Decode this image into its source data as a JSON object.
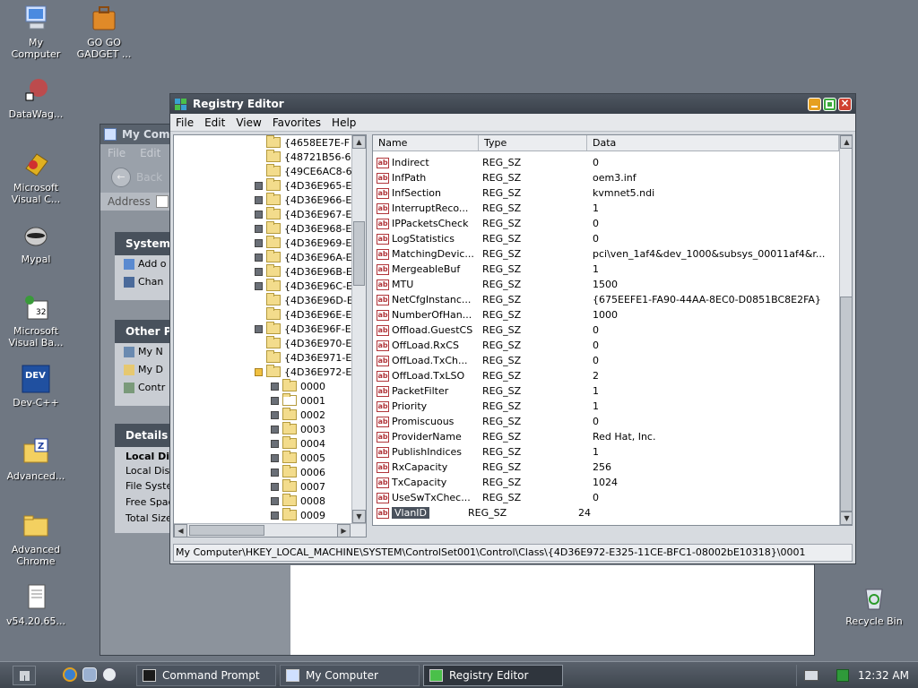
{
  "desktop": {
    "icons": [
      {
        "label": "My\nComputer",
        "icon": "computer-icon"
      },
      {
        "label": "GO GO\nGADGET ...",
        "icon": "briefcase-icon"
      },
      {
        "label": "DataWag...",
        "icon": "shortcut-icon"
      },
      {
        "label": "Microsoft\nVisual C...",
        "icon": "visual-c-icon"
      },
      {
        "label": "Mypal",
        "icon": "raccoon-icon"
      },
      {
        "label": "Microsoft\nVisual Ba...",
        "icon": "visual-basic-icon"
      },
      {
        "label": "Dev-C++",
        "icon": "dev-cpp-icon"
      },
      {
        "label": "Advanced...",
        "icon": "zip-folder-icon"
      },
      {
        "label": "Advanced\nChrome",
        "icon": "folder-icon"
      },
      {
        "label": "v54.20.65...",
        "icon": "document-icon"
      },
      {
        "label": "Recycle Bin",
        "icon": "recycle-bin-icon"
      }
    ]
  },
  "mycomputer": {
    "title": "My Com",
    "menu": [
      "File",
      "Edit"
    ],
    "back_label": "Back",
    "address_label": "Address",
    "system_tasks": {
      "title": "System T",
      "items": [
        "Add o",
        "Chan"
      ]
    },
    "other_places": {
      "title": "Other Pla",
      "items": [
        "My N",
        "My D",
        "Contr"
      ]
    },
    "details": {
      "title": "Details",
      "name": "Local Dis",
      "items": [
        "Local Disk",
        "File Syster",
        "Free Spac",
        "Total Size"
      ]
    }
  },
  "regedit": {
    "title": "Registry Editor",
    "menu": [
      "File",
      "Edit",
      "View",
      "Favorites",
      "Help"
    ],
    "tree": [
      {
        "label": "{4658EE7E-F",
        "expander": false,
        "level": 0
      },
      {
        "label": "{48721B56-6",
        "expander": false,
        "level": 0
      },
      {
        "label": "{49CE6AC8-6",
        "expander": false,
        "level": 0
      },
      {
        "label": "{4D36E965-E",
        "expander": true,
        "level": 0
      },
      {
        "label": "{4D36E966-E",
        "expander": true,
        "level": 0
      },
      {
        "label": "{4D36E967-E",
        "expander": true,
        "level": 0
      },
      {
        "label": "{4D36E968-E",
        "expander": true,
        "level": 0
      },
      {
        "label": "{4D36E969-E",
        "expander": true,
        "level": 0
      },
      {
        "label": "{4D36E96A-E",
        "expander": true,
        "level": 0
      },
      {
        "label": "{4D36E96B-E",
        "expander": true,
        "level": 0
      },
      {
        "label": "{4D36E96C-E",
        "expander": true,
        "level": 0
      },
      {
        "label": "{4D36E96D-E",
        "expander": false,
        "level": 0
      },
      {
        "label": "{4D36E96E-E",
        "expander": false,
        "level": 0
      },
      {
        "label": "{4D36E96F-E",
        "expander": true,
        "level": 0
      },
      {
        "label": "{4D36E970-E",
        "expander": false,
        "level": 0
      },
      {
        "label": "{4D36E971-E",
        "expander": false,
        "level": 0
      },
      {
        "label": "{4D36E972-E",
        "expander": true,
        "level": 0,
        "open": true
      },
      {
        "label": "0000",
        "expander": true,
        "level": 1
      },
      {
        "label": "0001",
        "expander": true,
        "level": 1,
        "selected": true
      },
      {
        "label": "0002",
        "expander": true,
        "level": 1
      },
      {
        "label": "0003",
        "expander": true,
        "level": 1
      },
      {
        "label": "0004",
        "expander": true,
        "level": 1
      },
      {
        "label": "0005",
        "expander": true,
        "level": 1
      },
      {
        "label": "0006",
        "expander": true,
        "level": 1
      },
      {
        "label": "0007",
        "expander": true,
        "level": 1
      },
      {
        "label": "0008",
        "expander": true,
        "level": 1
      },
      {
        "label": "0009",
        "expander": true,
        "level": 1
      }
    ],
    "columns": [
      "Name",
      "Type",
      "Data"
    ],
    "values": [
      {
        "name": "Indirect",
        "type": "REG_SZ",
        "data": "0"
      },
      {
        "name": "InfPath",
        "type": "REG_SZ",
        "data": "oem3.inf"
      },
      {
        "name": "InfSection",
        "type": "REG_SZ",
        "data": "kvmnet5.ndi"
      },
      {
        "name": "InterruptReco...",
        "type": "REG_SZ",
        "data": "1"
      },
      {
        "name": "IPPacketsCheck",
        "type": "REG_SZ",
        "data": "0"
      },
      {
        "name": "LogStatistics",
        "type": "REG_SZ",
        "data": "0"
      },
      {
        "name": "MatchingDevic...",
        "type": "REG_SZ",
        "data": "pci\\ven_1af4&dev_1000&subsys_00011af4&r..."
      },
      {
        "name": "MergeableBuf",
        "type": "REG_SZ",
        "data": "1"
      },
      {
        "name": "MTU",
        "type": "REG_SZ",
        "data": "1500"
      },
      {
        "name": "NetCfgInstanc...",
        "type": "REG_SZ",
        "data": "{675EEFE1-FA90-44AA-8EC0-D0851BC8E2FA}"
      },
      {
        "name": "NumberOfHan...",
        "type": "REG_SZ",
        "data": "1000"
      },
      {
        "name": "Offload.GuestCS",
        "type": "REG_SZ",
        "data": "0"
      },
      {
        "name": "OffLoad.RxCS",
        "type": "REG_SZ",
        "data": "0"
      },
      {
        "name": "OffLoad.TxCh...",
        "type": "REG_SZ",
        "data": "0"
      },
      {
        "name": "OffLoad.TxLSO",
        "type": "REG_SZ",
        "data": "2"
      },
      {
        "name": "PacketFilter",
        "type": "REG_SZ",
        "data": "1"
      },
      {
        "name": "Priority",
        "type": "REG_SZ",
        "data": "1"
      },
      {
        "name": "Promiscuous",
        "type": "REG_SZ",
        "data": "0"
      },
      {
        "name": "ProviderName",
        "type": "REG_SZ",
        "data": "Red Hat, Inc."
      },
      {
        "name": "PublishIndices",
        "type": "REG_SZ",
        "data": "1"
      },
      {
        "name": "RxCapacity",
        "type": "REG_SZ",
        "data": "256"
      },
      {
        "name": "TxCapacity",
        "type": "REG_SZ",
        "data": "1024"
      },
      {
        "name": "UseSwTxChec...",
        "type": "REG_SZ",
        "data": "0"
      },
      {
        "name": "VlanID",
        "type": "REG_SZ",
        "data": "24",
        "selected": true
      }
    ],
    "status_path": "My Computer\\HKEY_LOCAL_MACHINE\\SYSTEM\\ControlSet001\\Control\\Class\\{4D36E972-E325-11CE-BFC1-08002bE10318}\\0001"
  },
  "taskbar": {
    "tasks": [
      {
        "label": "Command Prompt",
        "icon": "cmd-icon"
      },
      {
        "label": "My Computer",
        "icon": "computer-icon"
      },
      {
        "label": "Registry Editor",
        "icon": "regedit-icon",
        "active": true
      }
    ],
    "clock": "12:32 AM"
  }
}
